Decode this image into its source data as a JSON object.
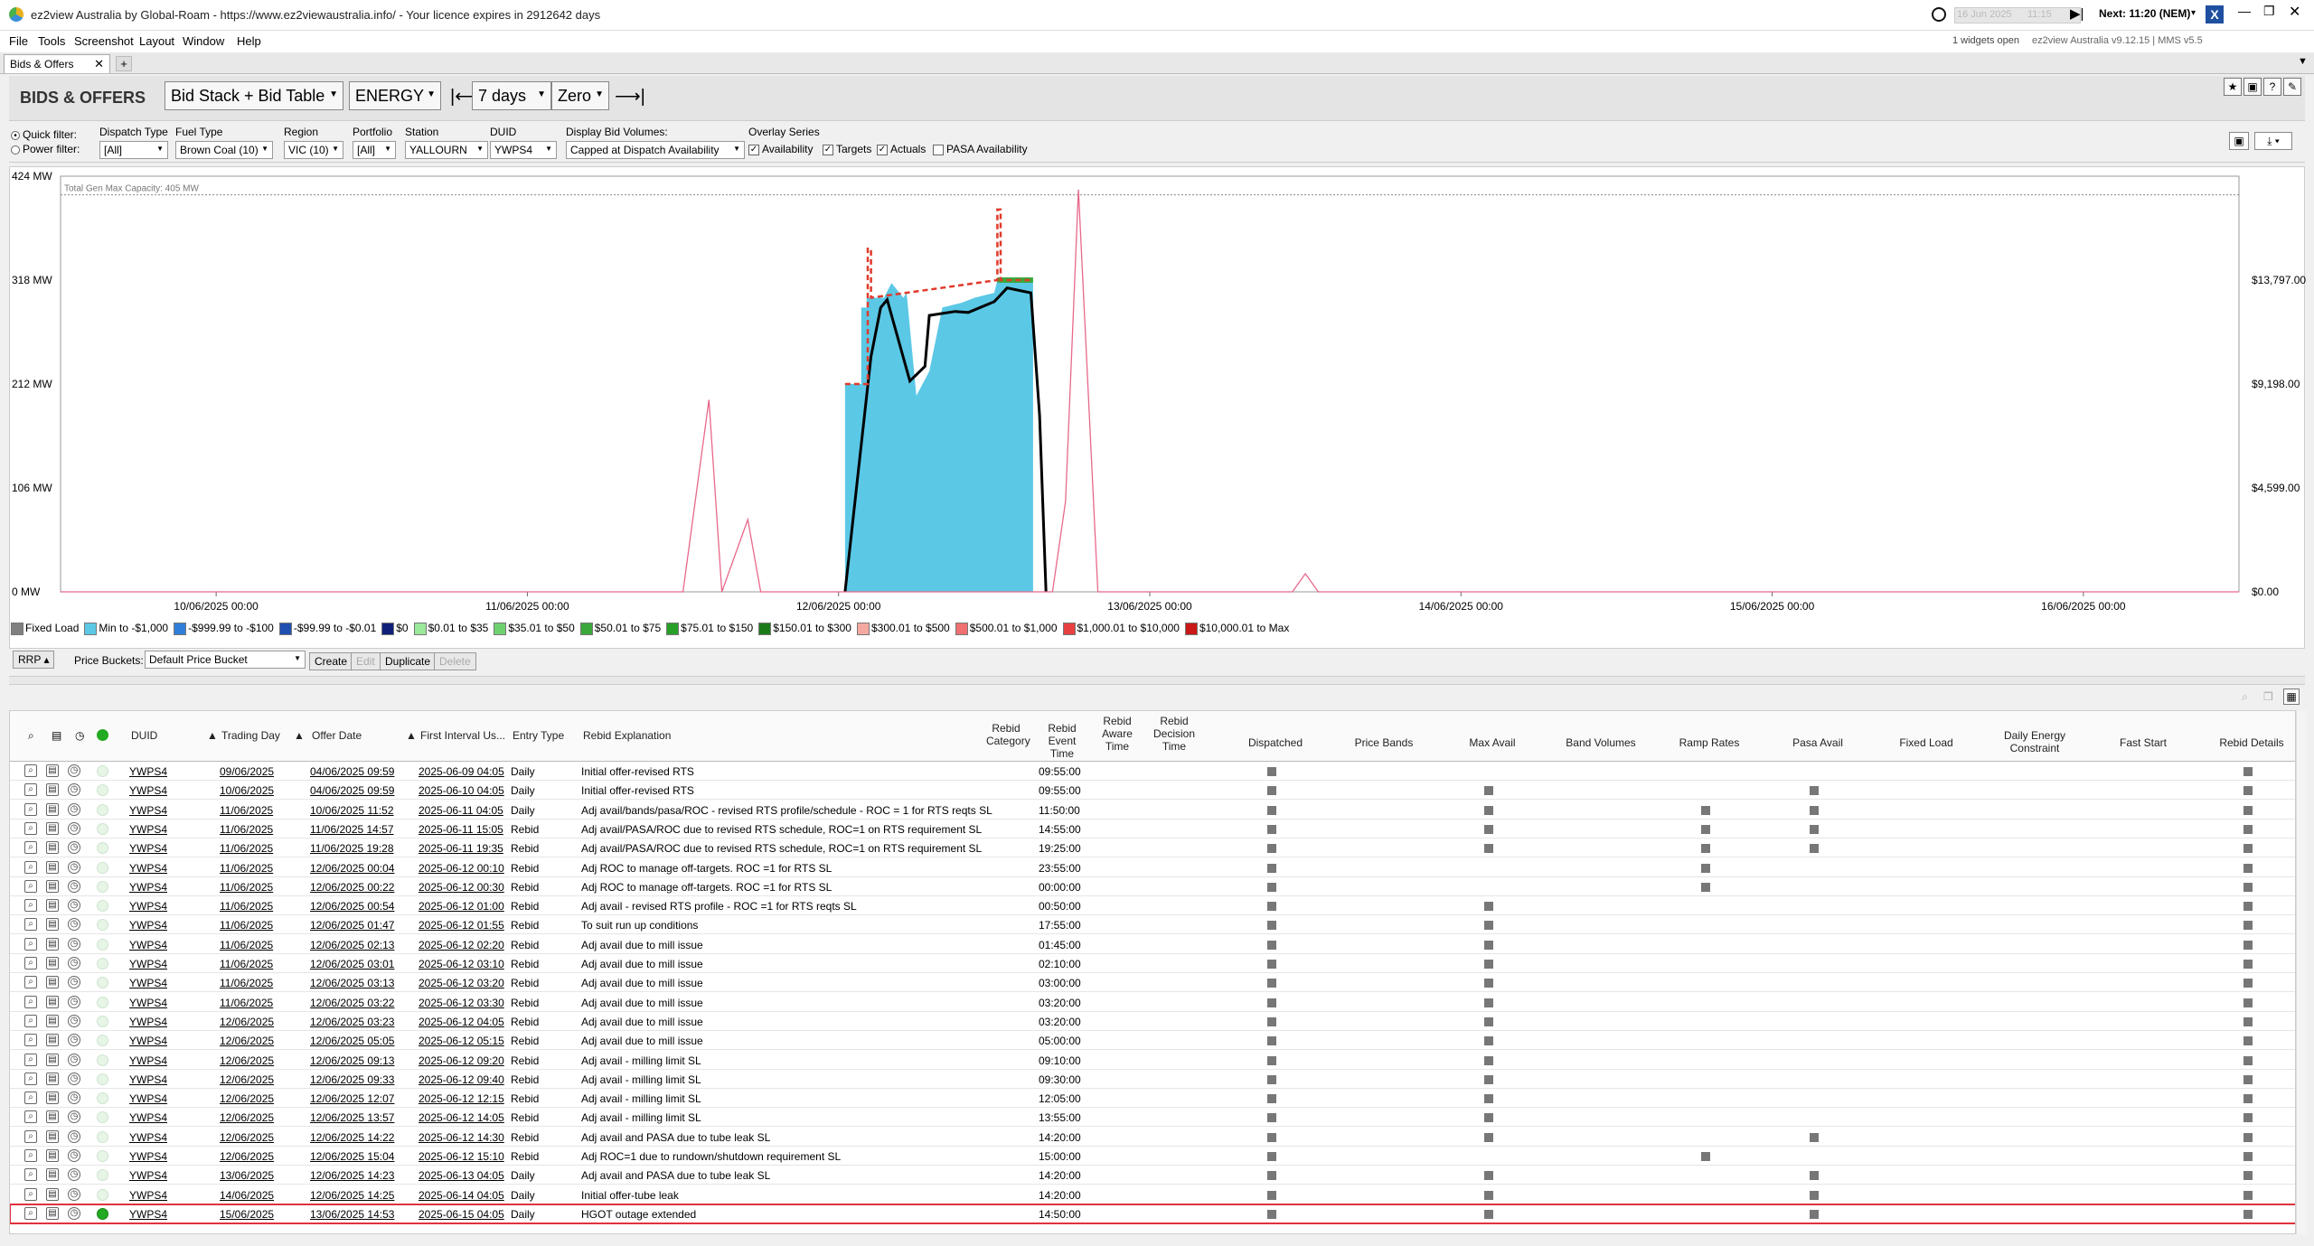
{
  "window": {
    "title": "ez2view Australia by Global-Roam - https://www.ez2viewaustralia.info/ - Your licence expires in 2912642 days",
    "time_slider_date": "16 Jun 2025",
    "time_slider_time": "11:15",
    "next_interval": "Next: 11:20 (NEM)",
    "widgets_open": "1 widgets open",
    "version": "ez2view Australia v9.12.15 | MMS v5.5"
  },
  "menu": [
    "File",
    "Tools",
    "Screenshot",
    "Layout",
    "Window",
    "Help"
  ],
  "tab": {
    "label": "Bids & Offers",
    "add": "+"
  },
  "toolbar": {
    "heading": "BIDS & OFFERS",
    "view": "Bid Stack + Bid Table",
    "market": "ENERGY",
    "range": "7 days",
    "zero": "Zero"
  },
  "filters": {
    "quick_filter": "Quick filter:",
    "power_filter": "Power filter:",
    "dispatch_type_label": "Dispatch Type",
    "dispatch_type": "[All]",
    "fuel_type_label": "Fuel Type",
    "fuel_type": "Brown Coal (10)",
    "region_label": "Region",
    "region": "VIC (10)",
    "portfolio_label": "Portfolio",
    "portfolio": "[All]",
    "station_label": "Station",
    "station": "YALLOURN",
    "duid_label": "DUID",
    "duid": "YWPS4",
    "display_vol_label": "Display Bid Volumes:",
    "display_vol": "Capped at Dispatch Availability",
    "overlay_label": "Overlay Series",
    "availability": "Availability",
    "targets": "Targets",
    "actuals": "Actuals",
    "pasa": "PASA Availability"
  },
  "chart": {
    "y_left": [
      "424 MW",
      "318 MW",
      "212 MW",
      "106 MW",
      "0 MW"
    ],
    "y_right": [
      "$13,797.00",
      "$9,198.00",
      "$4,599.00",
      "$0.00"
    ],
    "x_labels": [
      "10/06/2025 00:00",
      "11/06/2025 00:00",
      "12/06/2025 00:00",
      "13/06/2025 00:00",
      "14/06/2025 00:00",
      "15/06/2025 00:00",
      "16/06/2025 00:00"
    ],
    "capacity_label": "Total Gen Max Capacity: 405 MW"
  },
  "chart_data": {
    "type": "area",
    "title": "",
    "ylabel_left": "MW",
    "ylabel_right": "$/MWh",
    "ylim": [
      0,
      424
    ],
    "y2lim": [
      0,
      18396
    ],
    "x_range": [
      "2025-06-09 12:00",
      "2025-06-16 12:00"
    ],
    "capacity_MW": 405,
    "series": [
      {
        "name": "Min to -$1,000",
        "color": "#5bc8e6",
        "points": [
          [
            "2025-06-12 00:30",
            0
          ],
          [
            "2025-06-12 00:30",
            212
          ],
          [
            "2025-06-12 01:45",
            212
          ],
          [
            "2025-06-12 01:45",
            290
          ],
          [
            "2025-06-12 02:10",
            290
          ],
          [
            "2025-06-12 02:10",
            300
          ],
          [
            "2025-06-12 03:30",
            300
          ],
          [
            "2025-06-12 04:05",
            315
          ],
          [
            "2025-06-12 05:00",
            300
          ],
          [
            "2025-06-12 05:15",
            305
          ],
          [
            "2025-06-12 06:00",
            200
          ],
          [
            "2025-06-12 07:00",
            225
          ],
          [
            "2025-06-12 08:00",
            290
          ],
          [
            "2025-06-12 09:30",
            295
          ],
          [
            "2025-06-12 10:30",
            300
          ],
          [
            "2025-06-12 12:00",
            305
          ],
          [
            "2025-06-12 12:15",
            318
          ],
          [
            "2025-06-12 15:00",
            318
          ],
          [
            "2025-06-12 15:00",
            0
          ]
        ]
      },
      {
        "name": "$50.01 to $75",
        "color": "#3aa83a",
        "points": [
          [
            "2025-06-12 12:15",
            318
          ],
          [
            "2025-06-12 15:00",
            318
          ]
        ]
      },
      {
        "name": "Actuals",
        "color": "#000000",
        "points": [
          [
            "2025-06-12 00:30",
            0
          ],
          [
            "2025-06-12 01:30",
            120
          ],
          [
            "2025-06-12 02:30",
            240
          ],
          [
            "2025-06-12 03:15",
            290
          ],
          [
            "2025-06-12 03:45",
            298
          ],
          [
            "2025-06-12 05:30",
            215
          ],
          [
            "2025-06-12 06:40",
            230
          ],
          [
            "2025-06-12 07:00",
            282
          ],
          [
            "2025-06-12 09:00",
            286
          ],
          [
            "2025-06-12 10:00",
            285
          ],
          [
            "2025-06-12 12:00",
            296
          ],
          [
            "2025-06-12 13:00",
            310
          ],
          [
            "2025-06-12 14:50",
            305
          ],
          [
            "2025-06-12 15:30",
            180
          ],
          [
            "2025-06-12 16:00",
            0
          ]
        ]
      },
      {
        "name": "Availability",
        "color": "#e03a2a",
        "points": [
          [
            "2025-06-12 00:30",
            212
          ],
          [
            "2025-06-12 02:15",
            212
          ],
          [
            "2025-06-12 02:15",
            350
          ],
          [
            "2025-06-12 02:30",
            350
          ],
          [
            "2025-06-12 02:30",
            300
          ],
          [
            "2025-06-12 12:15",
            318
          ],
          [
            "2025-06-12 12:15",
            390
          ],
          [
            "2025-06-12 12:30",
            390
          ],
          [
            "2025-06-12 12:30",
            318
          ],
          [
            "2025-06-12 15:00",
            318
          ]
        ]
      },
      {
        "name": "RRP",
        "color": "#e8688a",
        "axis": "right",
        "points": [
          [
            "2025-06-09 12:00",
            0
          ],
          [
            "2025-06-11 12:00",
            0
          ],
          [
            "2025-06-11 14:00",
            8500
          ],
          [
            "2025-06-11 15:00",
            0
          ],
          [
            "2025-06-11 17:00",
            3200
          ],
          [
            "2025-06-11 18:00",
            0
          ],
          [
            "2025-06-12 00:00",
            0
          ],
          [
            "2025-06-12 16:30",
            0
          ],
          [
            "2025-06-12 17:30",
            4000
          ],
          [
            "2025-06-12 18:30",
            17800
          ],
          [
            "2025-06-12 20:00",
            0
          ],
          [
            "2025-06-13 11:00",
            0
          ],
          [
            "2025-06-13 12:00",
            800
          ],
          [
            "2025-06-13 13:00",
            0
          ],
          [
            "2025-06-16 12:00",
            0
          ]
        ]
      }
    ]
  },
  "legend": [
    {
      "label": "Fixed Load",
      "color": "#808080"
    },
    {
      "label": "Min to -$1,000",
      "color": "#5bc8e6"
    },
    {
      "label": "-$999.99 to -$100",
      "color": "#2f7fd8"
    },
    {
      "label": "-$99.99 to -$0.01",
      "color": "#1f4fb0"
    },
    {
      "label": "$0",
      "color": "#10207a"
    },
    {
      "label": "$0.01 to $35",
      "color": "#9be89b"
    },
    {
      "label": "$35.01 to $50",
      "color": "#6fd26f"
    },
    {
      "label": "$50.01 to $75",
      "color": "#3aa83a"
    },
    {
      "label": "$75.01 to $150",
      "color": "#28a028"
    },
    {
      "label": "$150.01 to $300",
      "color": "#1a7a1a"
    },
    {
      "label": "$300.01 to $500",
      "color": "#f4a8a0"
    },
    {
      "label": "$500.01 to $1,000",
      "color": "#ee7070"
    },
    {
      "label": "$1,000.01 to $10,000",
      "color": "#e84040"
    },
    {
      "label": "$10,000.01 to Max",
      "color": "#c81818"
    }
  ],
  "pricebar": {
    "rrp": "RRP",
    "buckets_label": "Price Buckets:",
    "bucket": "Default Price Bucket",
    "create": "Create",
    "edit": "Edit",
    "duplicate": "Duplicate",
    "delete": "Delete"
  },
  "grid": {
    "headers": {
      "duid": "DUID",
      "trading_day": "Trading Day",
      "offer_date": "Offer Date",
      "first_interval": "First Interval Us...",
      "entry_type": "Entry Type",
      "rebid_explanation": "Rebid Explanation",
      "rebid_category": "Rebid Category",
      "rebid_event_time": "Rebid Event Time",
      "rebid_aware_time": "Rebid Aware Time",
      "rebid_decision_time": "Rebid Decision Time",
      "dispatched": "Dispatched",
      "price_bands": "Price Bands",
      "max_avail": "Max Avail",
      "band_volumes": "Band Volumes",
      "ramp_rates": "Ramp Rates",
      "pasa_avail": "Pasa Avail",
      "fixed_load": "Fixed Load",
      "daily_energy": "Daily Energy Constraint",
      "fast_start": "Fast Start",
      "rebid_details": "Rebid Details"
    },
    "rows": [
      {
        "duid": "YWPS4",
        "day": "09/06/2025",
        "offer": "04/06/2025 09:59",
        "first": "2025-06-09 04:05",
        "type": "Daily",
        "expl": "Initial offer-revised RTS",
        "event": "09:55:00",
        "marks": [
          1,
          0,
          0,
          0,
          0,
          0,
          1
        ]
      },
      {
        "duid": "YWPS4",
        "day": "10/06/2025",
        "offer": "04/06/2025 09:59",
        "first": "2025-06-10 04:05",
        "type": "Daily",
        "expl": "Initial offer-revised RTS",
        "event": "09:55:00",
        "marks": [
          1,
          1,
          0,
          0,
          1,
          0,
          1
        ]
      },
      {
        "duid": "YWPS4",
        "day": "11/06/2025",
        "offer": "10/06/2025 11:52",
        "first": "2025-06-11 04:05",
        "type": "Daily",
        "expl": "Adj avail/bands/pasa/ROC - revised RTS profile/schedule - ROC = 1 for RTS reqts SL",
        "event": "11:50:00",
        "marks": [
          1,
          1,
          0,
          1,
          1,
          0,
          1
        ]
      },
      {
        "duid": "YWPS4",
        "day": "11/06/2025",
        "offer": "11/06/2025 14:57",
        "first": "2025-06-11 15:05",
        "type": "Rebid",
        "expl": "Adj avail/PASA/ROC due to revised RTS schedule, ROC=1 on RTS requirement SL",
        "event": "14:55:00",
        "marks": [
          1,
          1,
          0,
          1,
          1,
          0,
          1
        ]
      },
      {
        "duid": "YWPS4",
        "day": "11/06/2025",
        "offer": "11/06/2025 19:28",
        "first": "2025-06-11 19:35",
        "type": "Rebid",
        "expl": "Adj avail/PASA/ROC due to revised RTS schedule, ROC=1 on RTS requirement SL",
        "event": "19:25:00",
        "marks": [
          1,
          1,
          0,
          1,
          1,
          0,
          1
        ]
      },
      {
        "duid": "YWPS4",
        "day": "11/06/2025",
        "offer": "12/06/2025 00:04",
        "first": "2025-06-12 00:10",
        "type": "Rebid",
        "expl": "Adj ROC to manage off-targets. ROC =1 for RTS SL",
        "event": "23:55:00",
        "marks": [
          1,
          0,
          0,
          1,
          0,
          0,
          1
        ]
      },
      {
        "duid": "YWPS4",
        "day": "11/06/2025",
        "offer": "12/06/2025 00:22",
        "first": "2025-06-12 00:30",
        "type": "Rebid",
        "expl": "Adj ROC to manage off-targets. ROC =1 for RTS SL",
        "event": "00:00:00",
        "marks": [
          1,
          0,
          0,
          1,
          0,
          0,
          1
        ]
      },
      {
        "duid": "YWPS4",
        "day": "11/06/2025",
        "offer": "12/06/2025 00:54",
        "first": "2025-06-12 01:00",
        "type": "Rebid",
        "expl": "Adj avail - revised RTS profile - ROC =1 for RTS reqts SL",
        "event": "00:50:00",
        "marks": [
          1,
          1,
          0,
          0,
          0,
          0,
          1
        ]
      },
      {
        "duid": "YWPS4",
        "day": "11/06/2025",
        "offer": "12/06/2025 01:47",
        "first": "2025-06-12 01:55",
        "type": "Rebid",
        "expl": "To suit run up conditions",
        "event": "17:55:00",
        "marks": [
          1,
          1,
          0,
          0,
          0,
          0,
          1
        ]
      },
      {
        "duid": "YWPS4",
        "day": "11/06/2025",
        "offer": "12/06/2025 02:13",
        "first": "2025-06-12 02:20",
        "type": "Rebid",
        "expl": "Adj avail due to mill issue",
        "event": "01:45:00",
        "marks": [
          1,
          1,
          0,
          0,
          0,
          0,
          1
        ]
      },
      {
        "duid": "YWPS4",
        "day": "11/06/2025",
        "offer": "12/06/2025 03:01",
        "first": "2025-06-12 03:10",
        "type": "Rebid",
        "expl": "Adj avail due to mill issue",
        "event": "02:10:00",
        "marks": [
          1,
          1,
          0,
          0,
          0,
          0,
          1
        ]
      },
      {
        "duid": "YWPS4",
        "day": "11/06/2025",
        "offer": "12/06/2025 03:13",
        "first": "2025-06-12 03:20",
        "type": "Rebid",
        "expl": "Adj avail due to mill issue",
        "event": "03:00:00",
        "marks": [
          1,
          1,
          0,
          0,
          0,
          0,
          1
        ]
      },
      {
        "duid": "YWPS4",
        "day": "11/06/2025",
        "offer": "12/06/2025 03:22",
        "first": "2025-06-12 03:30",
        "type": "Rebid",
        "expl": "Adj avail due to mill issue",
        "event": "03:20:00",
        "marks": [
          1,
          1,
          0,
          0,
          0,
          0,
          1
        ]
      },
      {
        "duid": "YWPS4",
        "day": "12/06/2025",
        "offer": "12/06/2025 03:23",
        "first": "2025-06-12 04:05",
        "type": "Rebid",
        "expl": "Adj avail due to mill issue",
        "event": "03:20:00",
        "marks": [
          1,
          1,
          0,
          0,
          0,
          0,
          1
        ]
      },
      {
        "duid": "YWPS4",
        "day": "12/06/2025",
        "offer": "12/06/2025 05:05",
        "first": "2025-06-12 05:15",
        "type": "Rebid",
        "expl": "Adj avail due to mill issue",
        "event": "05:00:00",
        "marks": [
          1,
          1,
          0,
          0,
          0,
          0,
          1
        ]
      },
      {
        "duid": "YWPS4",
        "day": "12/06/2025",
        "offer": "12/06/2025 09:13",
        "first": "2025-06-12 09:20",
        "type": "Rebid",
        "expl": "Adj avail - milling limit SL",
        "event": "09:10:00",
        "marks": [
          1,
          1,
          0,
          0,
          0,
          0,
          1
        ]
      },
      {
        "duid": "YWPS4",
        "day": "12/06/2025",
        "offer": "12/06/2025 09:33",
        "first": "2025-06-12 09:40",
        "type": "Rebid",
        "expl": "Adj avail - milling limit SL",
        "event": "09:30:00",
        "marks": [
          1,
          1,
          0,
          0,
          0,
          0,
          1
        ]
      },
      {
        "duid": "YWPS4",
        "day": "12/06/2025",
        "offer": "12/06/2025 12:07",
        "first": "2025-06-12 12:15",
        "type": "Rebid",
        "expl": "Adj avail - milling limit SL",
        "event": "12:05:00",
        "marks": [
          1,
          1,
          0,
          0,
          0,
          0,
          1
        ]
      },
      {
        "duid": "YWPS4",
        "day": "12/06/2025",
        "offer": "12/06/2025 13:57",
        "first": "2025-06-12 14:05",
        "type": "Rebid",
        "expl": "Adj avail - milling limit SL",
        "event": "13:55:00",
        "marks": [
          1,
          1,
          0,
          0,
          0,
          0,
          1
        ]
      },
      {
        "duid": "YWPS4",
        "day": "12/06/2025",
        "offer": "12/06/2025 14:22",
        "first": "2025-06-12 14:30",
        "type": "Rebid",
        "expl": "Adj avail and PASA due to tube leak SL",
        "event": "14:20:00",
        "marks": [
          1,
          1,
          0,
          0,
          1,
          0,
          1
        ]
      },
      {
        "duid": "YWPS4",
        "day": "12/06/2025",
        "offer": "12/06/2025 15:04",
        "first": "2025-06-12 15:10",
        "type": "Rebid",
        "expl": "Adj ROC=1 due to rundown/shutdown requirement SL",
        "event": "15:00:00",
        "marks": [
          1,
          0,
          0,
          1,
          0,
          0,
          1
        ]
      },
      {
        "duid": "YWPS4",
        "day": "13/06/2025",
        "offer": "12/06/2025 14:23",
        "first": "2025-06-13 04:05",
        "type": "Daily",
        "expl": "Adj avail and PASA due to tube leak SL",
        "event": "14:20:00",
        "marks": [
          1,
          1,
          0,
          0,
          1,
          0,
          1
        ]
      },
      {
        "duid": "YWPS4",
        "day": "14/06/2025",
        "offer": "12/06/2025 14:25",
        "first": "2025-06-14 04:05",
        "type": "Daily",
        "expl": "Initial offer-tube leak",
        "event": "14:20:00",
        "marks": [
          1,
          1,
          0,
          0,
          1,
          0,
          1
        ]
      },
      {
        "duid": "YWPS4",
        "day": "15/06/2025",
        "offer": "13/06/2025 14:53",
        "first": "2025-06-15 04:05",
        "type": "Daily",
        "expl": "HGOT outage extended",
        "event": "14:50:00",
        "marks": [
          1,
          1,
          0,
          0,
          1,
          0,
          1
        ],
        "selected": true
      }
    ]
  }
}
